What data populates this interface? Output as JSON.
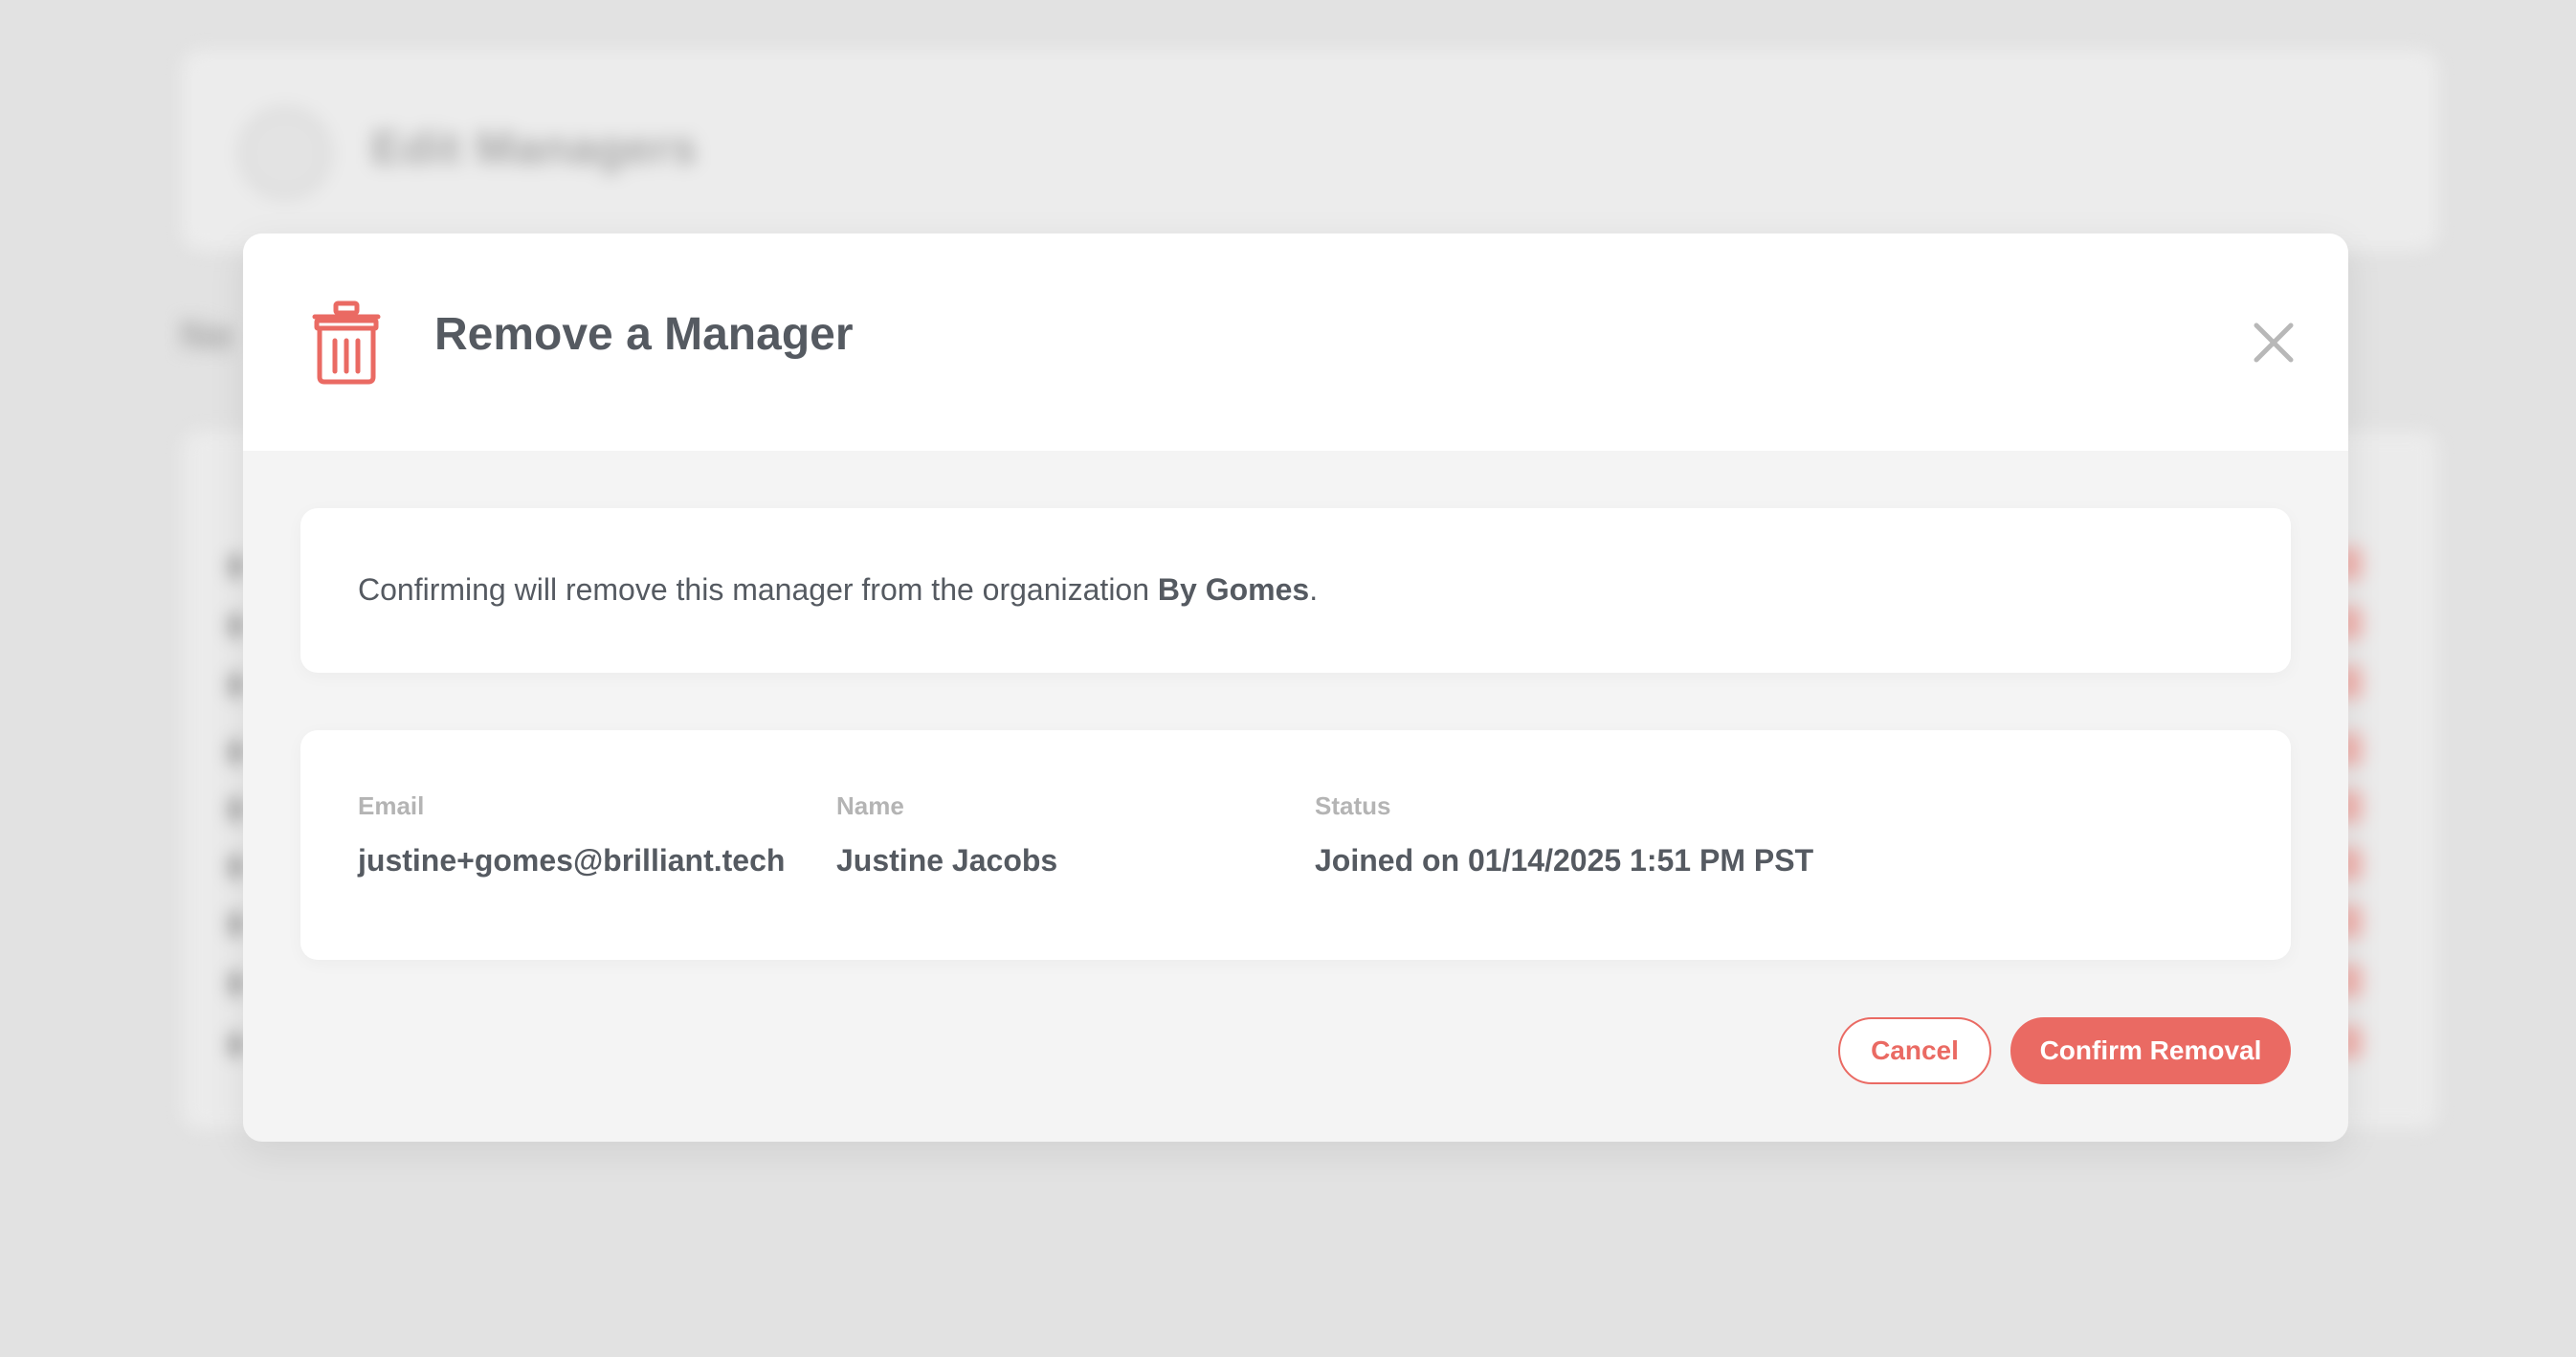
{
  "background": {
    "page_title": "Edit Managers",
    "section_title": "Ne"
  },
  "modal": {
    "title": "Remove a Manager",
    "header_icon": "trash-icon",
    "close_icon": "close-icon",
    "message": {
      "prefix": "Confirming will remove this manager from the organization ",
      "organization": "By Gomes",
      "suffix": "."
    },
    "manager": {
      "email_label": "Email",
      "email": "justine+gomes@brilliant.tech",
      "name_label": "Name",
      "name": "Justine Jacobs",
      "status_label": "Status",
      "status": "Joined on 01/14/2025 1:51 PM PST"
    },
    "buttons": {
      "cancel": "Cancel",
      "confirm": "Confirm Removal"
    }
  },
  "colors": {
    "accent": "#ea6a63",
    "text": "#555a61",
    "muted_label": "#b4b4b4",
    "backdrop": "#dedede",
    "modal_body": "#f4f4f4"
  }
}
